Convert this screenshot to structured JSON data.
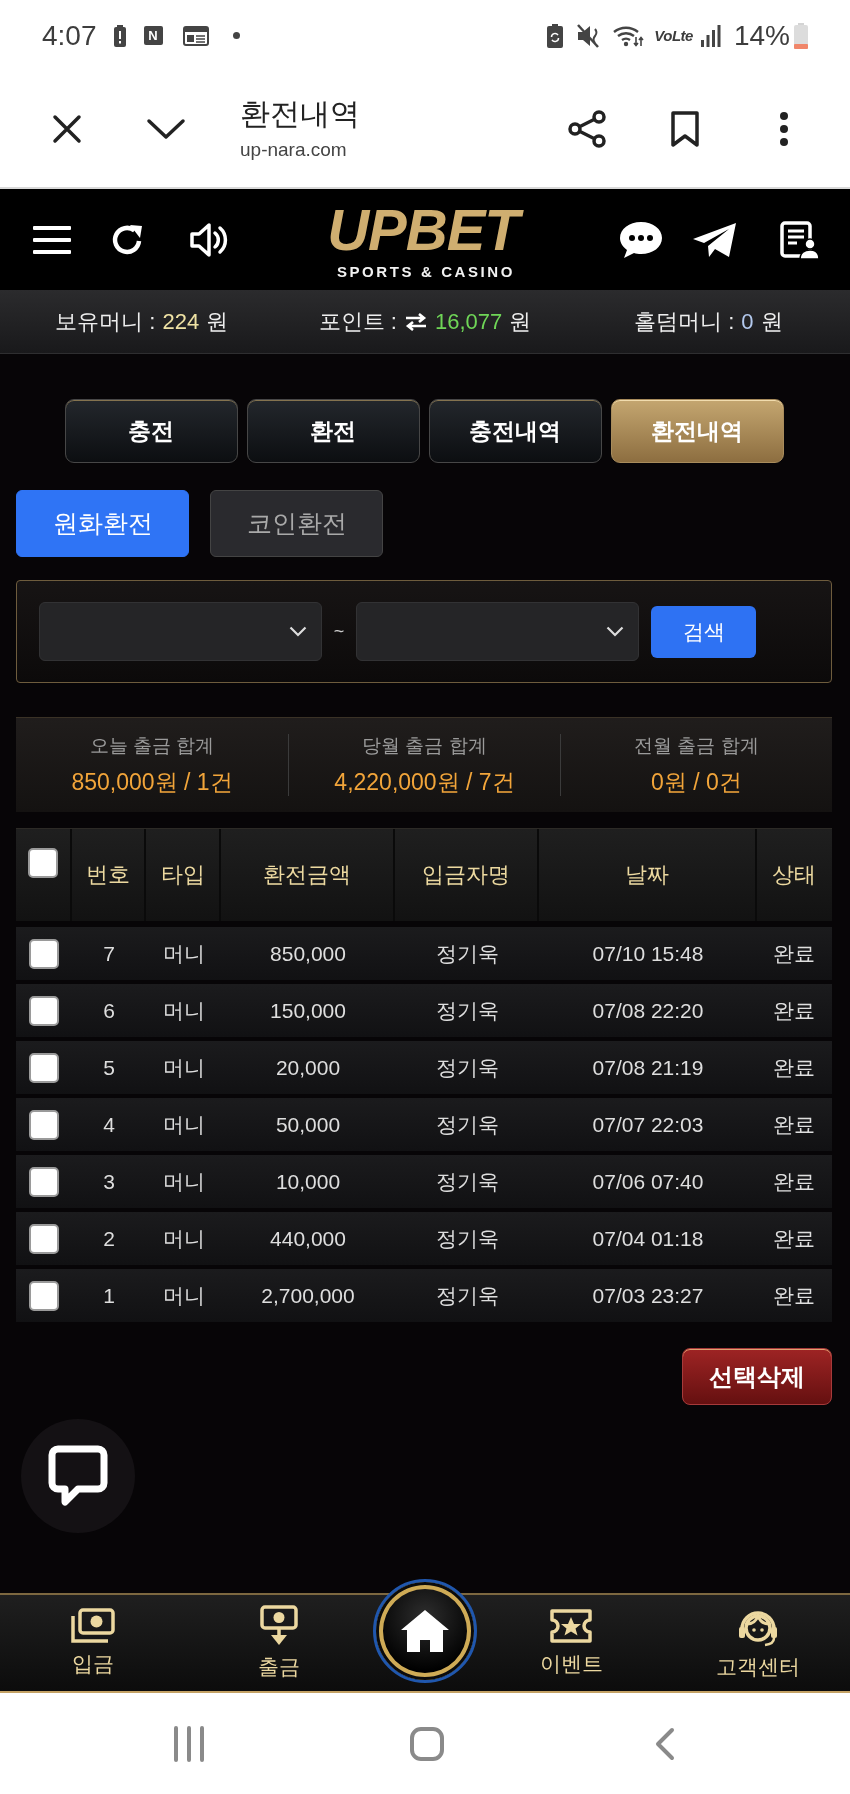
{
  "status_bar": {
    "time": "4:07",
    "app_badge": "N",
    "network": "VoLte",
    "battery": "14%"
  },
  "browser_bar": {
    "title": "환전내역",
    "url": "up-nara.com"
  },
  "site_header": {
    "logo": "UPBET",
    "tagline": "SPORTS & CASINO"
  },
  "balances": [
    {
      "kind": "money",
      "label": "보유머니 :",
      "value": "224",
      "unit": "원",
      "color": "#efe2a4"
    },
    {
      "kind": "points",
      "label": "포인트 :",
      "value": "16,077",
      "unit": "원",
      "color": "#6fd657"
    },
    {
      "kind": "money",
      "label": "홀덤머니 :",
      "value": "0",
      "unit": "원",
      "color": "#b3c9ee"
    }
  ],
  "tabs": [
    {
      "label": "충전",
      "selected": false
    },
    {
      "label": "환전",
      "selected": false
    },
    {
      "label": "충전내역",
      "selected": false
    },
    {
      "label": "환전내역",
      "selected": true
    }
  ],
  "sub_tabs": [
    {
      "label": "원화환전",
      "selected": true
    },
    {
      "label": "코인환전",
      "selected": false
    }
  ],
  "search": {
    "separator": "~",
    "button": "검색"
  },
  "summary": [
    {
      "label": "오늘 출금 합계",
      "value": "850,000원 / 1건"
    },
    {
      "label": "당월 출금 합계",
      "value": "4,220,000원 / 7건"
    },
    {
      "label": "전월 출금 합계",
      "value": "0원 / 0건"
    }
  ],
  "table": {
    "header_checked": false,
    "columns": [
      "번호",
      "타입",
      "환전금액",
      "입금자명",
      "날짜",
      "상태"
    ],
    "rows": [
      {
        "checked": false,
        "cells": [
          "7",
          "머니",
          "850,000",
          "정기욱",
          "07/10 15:48",
          "완료"
        ]
      },
      {
        "checked": false,
        "cells": [
          "6",
          "머니",
          "150,000",
          "정기욱",
          "07/08 22:20",
          "완료"
        ]
      },
      {
        "checked": false,
        "cells": [
          "5",
          "머니",
          "20,000",
          "정기욱",
          "07/08 21:19",
          "완료"
        ]
      },
      {
        "checked": false,
        "cells": [
          "4",
          "머니",
          "50,000",
          "정기욱",
          "07/07 22:03",
          "완료"
        ]
      },
      {
        "checked": false,
        "cells": [
          "3",
          "머니",
          "10,000",
          "정기욱",
          "07/06 07:40",
          "완료"
        ]
      },
      {
        "checked": false,
        "cells": [
          "2",
          "머니",
          "440,000",
          "정기욱",
          "07/04 01:18",
          "완료"
        ]
      },
      {
        "checked": false,
        "cells": [
          "1",
          "머니",
          "2,700,000",
          "정기욱",
          "07/03 23:27",
          "완료"
        ]
      }
    ]
  },
  "delete_button": "선택삭제",
  "bottom_nav": [
    {
      "kind": "deposit",
      "label": "입금"
    },
    {
      "kind": "withdraw",
      "label": "출금"
    },
    {
      "kind": "home"
    },
    {
      "kind": "event",
      "label": "이벤트"
    },
    {
      "kind": "support",
      "label": "고객센터"
    }
  ]
}
